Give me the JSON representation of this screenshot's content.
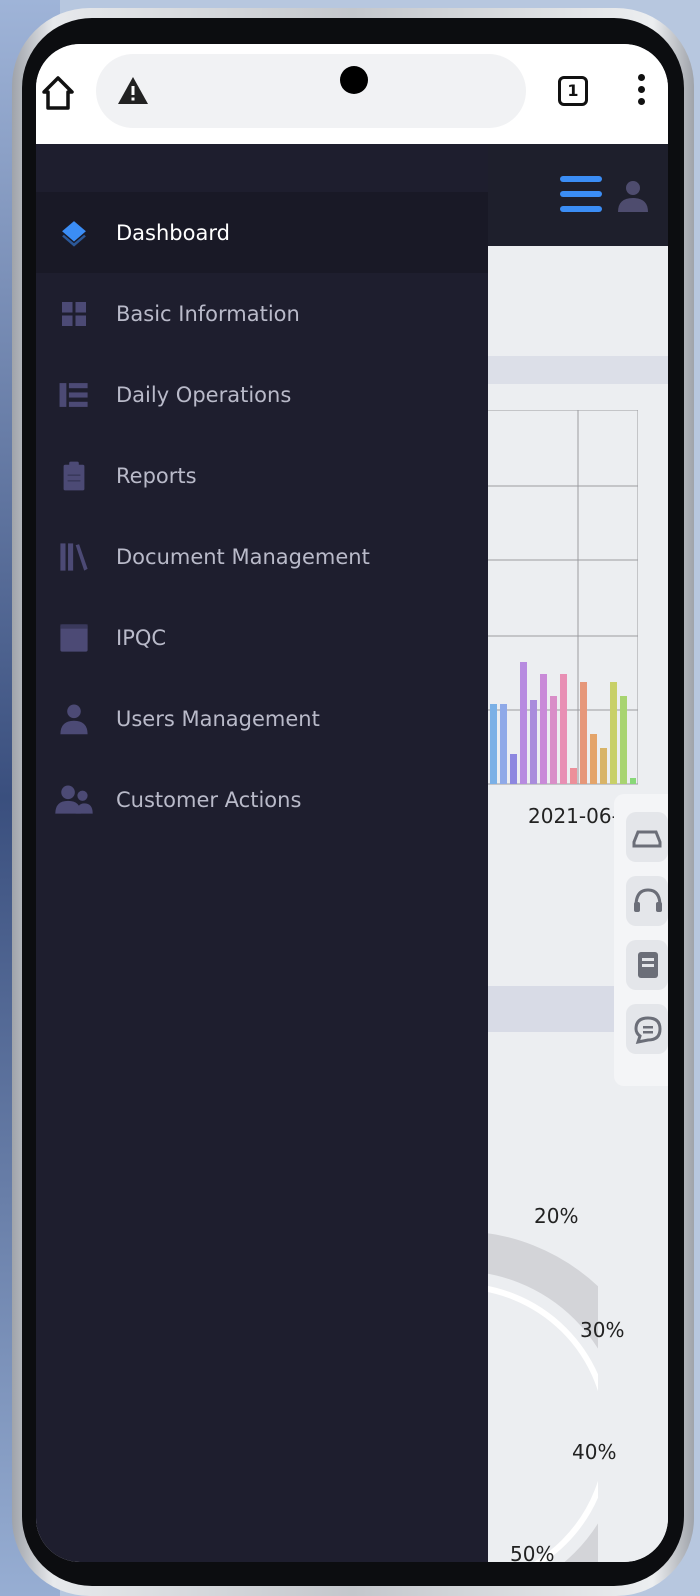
{
  "browser": {
    "tabs_count": "1"
  },
  "drawer": {
    "items": [
      {
        "label": "Dashboard",
        "icon": "layers-icon",
        "active": true
      },
      {
        "label": "Basic Information",
        "icon": "grid-icon",
        "active": false
      },
      {
        "label": "Daily Operations",
        "icon": "list-icon",
        "active": false
      },
      {
        "label": "Reports",
        "icon": "clipboard-icon",
        "active": false
      },
      {
        "label": "Document Management",
        "icon": "library-icon",
        "active": false
      },
      {
        "label": "IPQC",
        "icon": "box-icon",
        "active": false
      },
      {
        "label": "Users Management",
        "icon": "user-icon",
        "active": false
      },
      {
        "label": "Customer Actions",
        "icon": "users-icon",
        "active": false
      }
    ]
  },
  "background_content": {
    "chart_date_label": "2021-06-",
    "percent_labels": [
      "20%",
      "30%",
      "40%",
      "50%"
    ]
  },
  "colors": {
    "accent": "#3b8df5",
    "drawer_bg": "#1e1e2e",
    "icon_muted": "#4c4a75"
  }
}
